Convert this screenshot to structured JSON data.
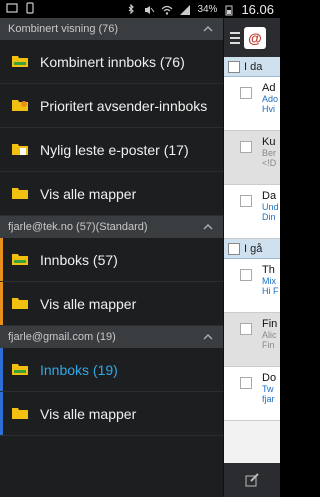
{
  "status_bar": {
    "battery": "34%",
    "time": "16.06",
    "left_icons": [
      "screen-icon",
      "notification-icon"
    ],
    "right_icons": [
      "bluetooth-icon",
      "mute-icon",
      "wifi-icon",
      "signal-icon",
      "battery-icon"
    ]
  },
  "drawer": {
    "sections": [
      {
        "header": "Kombinert visning (76)",
        "stripe": "",
        "items": [
          {
            "label": "Kombinert innboks (76)",
            "icon": "inbox-folder-icon",
            "active": false
          },
          {
            "label": "Prioritert avsender-innboks",
            "icon": "priority-sender-folder-icon",
            "active": false
          },
          {
            "label": "Nylig leste e-poster (17)",
            "icon": "recently-read-folder-icon",
            "active": false
          },
          {
            "label": "Vis alle mapper",
            "icon": "folder-icon",
            "active": false
          }
        ]
      },
      {
        "header": "fjarle@tek.no (57)(Standard)",
        "stripe": "orange",
        "items": [
          {
            "label": "Innboks (57)",
            "icon": "inbox-folder-icon",
            "active": false
          },
          {
            "label": "Vis alle mapper",
            "icon": "folder-icon",
            "active": false
          }
        ]
      },
      {
        "header": "fjarle@gmail.com (19)",
        "stripe": "blue",
        "items": [
          {
            "label": "Innboks (19)",
            "icon": "inbox-folder-icon",
            "active": true
          },
          {
            "label": "Vis alle mapper",
            "icon": "folder-icon",
            "active": false
          }
        ]
      }
    ]
  },
  "background_list": {
    "date_headers": [
      "I da",
      "I gå"
    ],
    "mails": [
      {
        "subject": "Ad",
        "line2": "Ado",
        "line3": "Hvi",
        "grey": false
      },
      {
        "subject": "Ku",
        "line2": "Ber",
        "line3": "<!D",
        "grey": true
      },
      {
        "subject": "Da",
        "line2": "Und",
        "line3": "Din",
        "grey": false
      },
      {
        "subject": "Th",
        "line2": "Mix",
        "line3": "Hi F",
        "grey": false
      },
      {
        "subject": "Fin",
        "line2": "Alic",
        "line3": "Fin",
        "grey": true
      },
      {
        "subject": "Do",
        "line2": "Tw",
        "line3": "fjar",
        "grey": false
      }
    ]
  },
  "colors": {
    "drawer_bg": "#1c1e20",
    "section_header_bg": "#3a3d40",
    "active_text": "#33a7e8",
    "account_tek": "#e8901c",
    "account_gmail": "#2e6fd6",
    "folder": "#f2c010"
  }
}
